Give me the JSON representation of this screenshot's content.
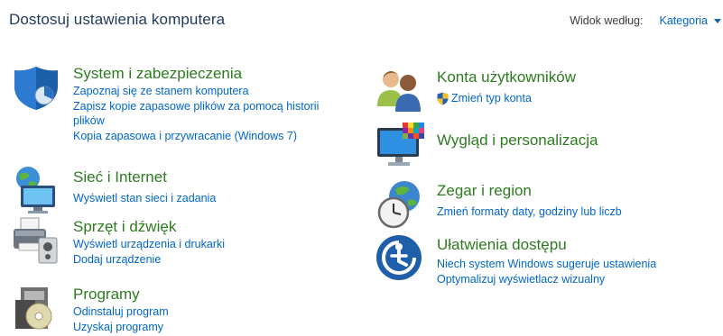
{
  "header": {
    "title": "Dostosuj ustawienia komputera",
    "view_by_label": "Widok według:",
    "view_by_value": "Kategoria"
  },
  "categories": {
    "system": {
      "title": "System i zabezpieczenia",
      "icon": "shield-icon",
      "links": [
        "Zapoznaj się ze stanem komputera",
        "Zapisz kopie zapasowe plików za pomocą historii plików",
        "Kopia zapasowa i przywracanie (Windows 7)"
      ]
    },
    "network": {
      "title": "Sieć i Internet",
      "icon": "network-globe-icon",
      "links": [
        "Wyświetl stan sieci i zadania"
      ]
    },
    "hardware": {
      "title": "Sprzęt i dźwięk",
      "icon": "printer-speaker-icon",
      "links": [
        "Wyświetl urządzenia i drukarki",
        "Dodaj urządzenie"
      ]
    },
    "programs": {
      "title": "Programy",
      "icon": "programs-disc-icon",
      "links": [
        "Odinstaluj program",
        "Uzyskaj programy"
      ]
    },
    "accounts": {
      "title": "Konta użytkowników",
      "icon": "users-icon",
      "links": [
        "Zmień typ konta"
      ]
    },
    "appearance": {
      "title": "Wygląd i personalizacja",
      "icon": "monitor-palette-icon",
      "links": []
    },
    "clock": {
      "title": "Zegar i region",
      "icon": "clock-globe-icon",
      "links": [
        "Zmień formaty daty, godziny lub liczb"
      ]
    },
    "ease": {
      "title": "Ułatwienia dostępu",
      "icon": "ease-of-access-icon",
      "links": [
        "Niech system Windows sugeruje ustawienia",
        "Optymalizuj wyświetlacz wizualny"
      ]
    }
  },
  "colors": {
    "category_title": "#2d7b1f",
    "link": "#0066cc",
    "page_title": "#1e395b"
  }
}
